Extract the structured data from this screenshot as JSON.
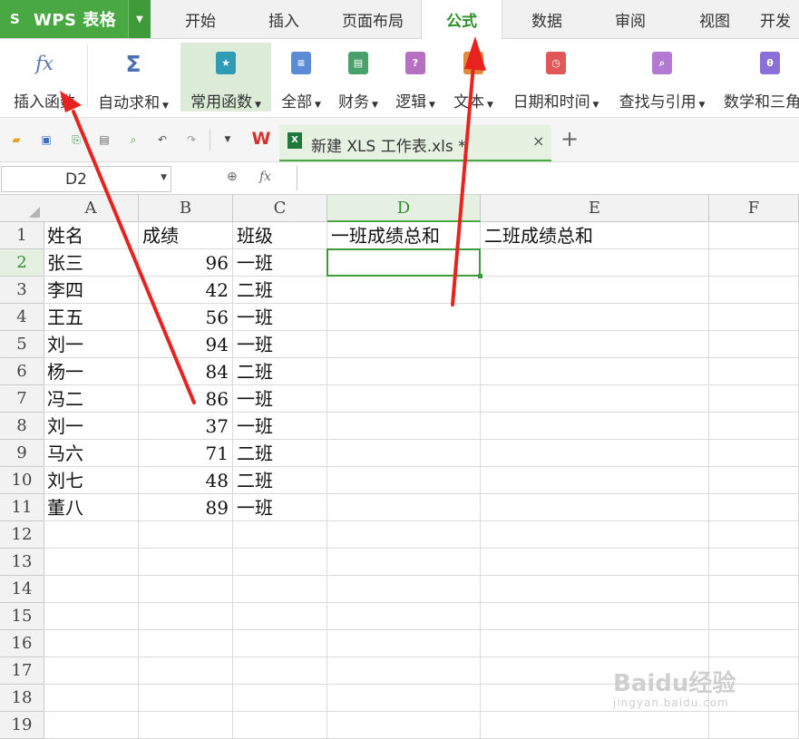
{
  "app": {
    "logo": "S",
    "title": "WPS 表格"
  },
  "menu_tabs": [
    "开始",
    "插入",
    "页面布局",
    "公式",
    "数据",
    "审阅",
    "视图",
    "开发"
  ],
  "active_tab": "公式",
  "ribbon": {
    "insert_function": "插入函数",
    "buttons": [
      {
        "label": "自动求和",
        "icon": "sigma-icon",
        "color": "#4a6fb5"
      },
      {
        "label": "常用函数",
        "icon": "star-book-icon",
        "color": "#2f9bb5"
      },
      {
        "label": "全部",
        "icon": "list-book-icon",
        "color": "#5b8bd4"
      },
      {
        "label": "财务",
        "icon": "finance-book-icon",
        "color": "#4aa06a"
      },
      {
        "label": "逻辑",
        "icon": "question-book-icon",
        "color": "#b56fc3"
      },
      {
        "label": "文本",
        "icon": "text-book-icon",
        "color": "#e08a3a"
      },
      {
        "label": "日期和时间",
        "icon": "clock-book-icon",
        "color": "#e05757"
      },
      {
        "label": "查找与引用",
        "icon": "search-book-icon",
        "color": "#b37ad4"
      },
      {
        "label": "数学和三角",
        "icon": "theta-book-icon",
        "color": "#8a6fd6"
      }
    ]
  },
  "quick_access": {
    "document_tab": "新建 XLS 工作表.xls *",
    "close": "×",
    "new_tab": "+",
    "wps_logo": "W"
  },
  "formula_bar": {
    "name_box": "D2",
    "fx": "fx",
    "zoom_icon": "⊕",
    "formula": ""
  },
  "sheet": {
    "columns": [
      "A",
      "B",
      "C",
      "D",
      "E",
      "F"
    ],
    "rows": [
      "1",
      "2",
      "3",
      "4",
      "5",
      "6",
      "7",
      "8",
      "9",
      "10",
      "11",
      "12",
      "13",
      "14",
      "15",
      "16",
      "17",
      "18",
      "19"
    ],
    "active_cell": "D2",
    "header_row": [
      "姓名",
      "成绩",
      "班级",
      "一班成绩总和",
      "二班成绩总和",
      ""
    ],
    "data": [
      [
        "张三",
        "96",
        "一班"
      ],
      [
        "李四",
        "42",
        "二班"
      ],
      [
        "王五",
        "56",
        "一班"
      ],
      [
        "刘一",
        "94",
        "一班"
      ],
      [
        "杨一",
        "84",
        "二班"
      ],
      [
        "冯二",
        "86",
        "一班"
      ],
      [
        "刘一",
        "37",
        "一班"
      ],
      [
        "马六",
        "71",
        "二班"
      ],
      [
        "刘七",
        "48",
        "二班"
      ],
      [
        "董八",
        "89",
        "一班"
      ]
    ]
  },
  "colors": {
    "accent": "#4aa843",
    "annotation_arrow": "#e8231f"
  },
  "watermark": {
    "line1": "Baidu经验",
    "line2": "jingyan.baidu.com"
  }
}
